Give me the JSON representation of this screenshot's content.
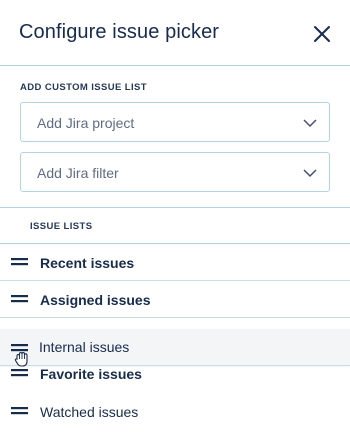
{
  "header": {
    "title": "Configure issue picker"
  },
  "add_section": {
    "label": "ADD CUSTOM ISSUE LIST",
    "project_select": {
      "placeholder": "Add Jira project"
    },
    "filter_select": {
      "placeholder": "Add Jira filter"
    }
  },
  "lists_section": {
    "label": "ISSUE LISTS",
    "items": [
      {
        "label": "Recent issues",
        "bold": true
      },
      {
        "label": "Assigned issues",
        "bold": true
      },
      {
        "label": "Favorite issues",
        "bold": true
      },
      {
        "label": "Watched issues",
        "bold": false
      }
    ],
    "dragging_item": {
      "label": "Internal issues"
    }
  },
  "colors": {
    "text": "#172b4d",
    "placeholder": "#5e6c84",
    "border": "#b3d4e0",
    "drag_bg": "#f4f5f7"
  },
  "icons": [
    "close-icon",
    "chevron-down-icon",
    "drag-handle-icon",
    "grab-cursor-icon"
  ]
}
